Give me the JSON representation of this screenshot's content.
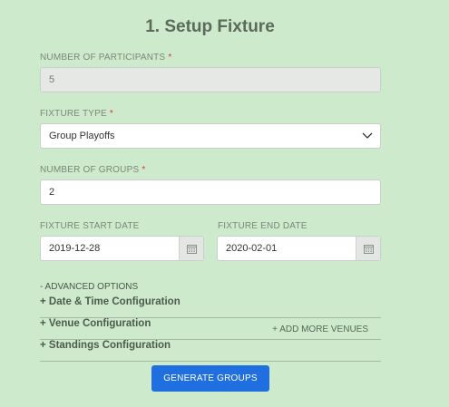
{
  "title": "1. Setup Fixture",
  "participants": {
    "label": "NUMBER OF PARTICIPANTS",
    "required": "*",
    "value": "5"
  },
  "fixture_type": {
    "label": "FIXTURE TYPE",
    "required": "*",
    "value": "Group Playoffs"
  },
  "groups": {
    "label": "NUMBER OF GROUPS",
    "required": "*",
    "value": "2"
  },
  "start_date": {
    "label": "FIXTURE START DATE",
    "value": "2019-12-28"
  },
  "end_date": {
    "label": "FIXTURE END DATE",
    "value": "2020-02-01"
  },
  "advanced": {
    "label": "- ADVANCED OPTIONS"
  },
  "sections": {
    "datetime": "+ Date & Time Configuration",
    "venue": "+ Venue Configuration",
    "add_venues": "+ ADD MORE VENUES",
    "standings": "+ Standings Configuration"
  },
  "generate_button": "GENERATE GROUPS",
  "colors": {
    "background": "#cdebcc",
    "primary": "#1f6fe0",
    "required": "#d23a3a"
  }
}
